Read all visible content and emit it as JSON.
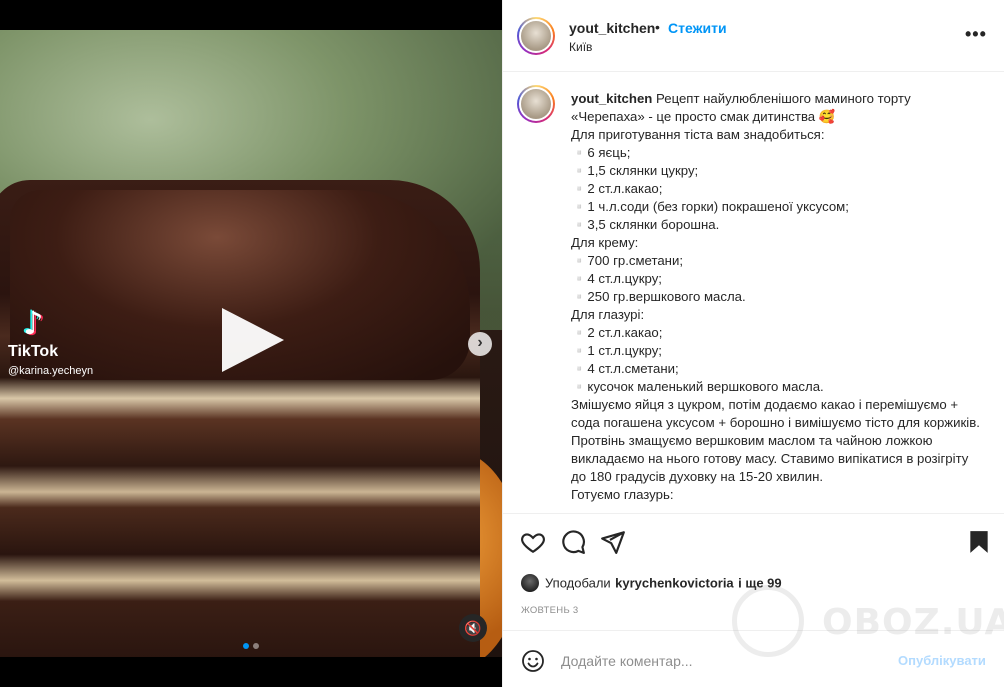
{
  "media": {
    "tiktok_logo": "♪",
    "tiktok_name": "TikTok",
    "tiktok_user": "@karina.yecheyn",
    "carousel_total": 2,
    "carousel_active": 1
  },
  "post": {
    "username": "yout_kitchen",
    "separator": "•",
    "follow_label": "Стежити",
    "location": "Київ",
    "more_label": "•••"
  },
  "caption": {
    "username": "yout_kitchen",
    "lines": [
      "Рецепт найулюбленішого маминого торту «Черепаха» - це просто смак дитинства 🥰",
      "Для приготування тіста вам знадобиться:",
      "▫️6 яєць;",
      "▫️1,5 склянки цукру;",
      "▫️2 ст.л.какао;",
      "▫️1 ч.л.соди (без горки) покрашеної уксусом;",
      "▫️3,5 склянки борошна.",
      "Для крему:",
      "▫️700 гр.сметани;",
      "▫️4 ст.л.цукру;",
      "▫️250 гр.вершкового масла.",
      "Для глазурі:",
      "▫️2 ст.л.какао;",
      "▫️1 ст.л.цукру;",
      "▫️4 ст.л.сметани;",
      "▫️кусочок маленький вершкового масла.",
      "Змішуємо яйця з цукром, потім додаємо какао і перемішуємо + сода погашена уксусом + борошно і вимішуємо тісто для коржиків. Протвінь змащуємо вершковим маслом та чайною ложкою викладаємо на нього готову масу. Ставимо випікатися в розігріту до 180 градусів духовку на 15-20 хвилин.",
      "Готуємо глазурь:"
    ]
  },
  "actions": {
    "likes_prefix": "Уподобали",
    "likes_user": "kyrychenkovictoria",
    "likes_suffix": "і ще 99",
    "date": "ЖОВТЕНЬ 3"
  },
  "comment": {
    "placeholder": "Додайте коментар...",
    "post_label": "Опублікувати"
  },
  "watermark": {
    "text": "OBOZ.UA"
  },
  "colors": {
    "accent": "#0095f6",
    "post_disabled": "#b3dbff"
  }
}
